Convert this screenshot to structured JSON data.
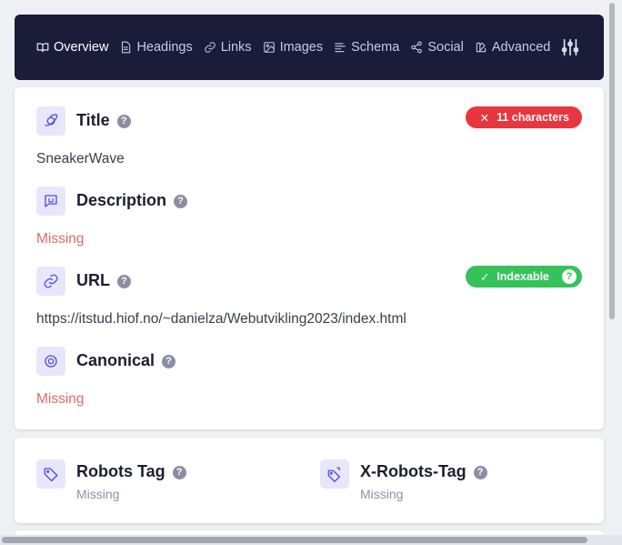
{
  "nav": {
    "items": [
      {
        "label": "Overview",
        "icon": "book-open-icon",
        "active": true
      },
      {
        "label": "Headings",
        "icon": "document-icon",
        "active": false
      },
      {
        "label": "Links",
        "icon": "link-icon",
        "active": false
      },
      {
        "label": "Images",
        "icon": "image-icon",
        "active": false
      },
      {
        "label": "Schema",
        "icon": "align-left-icon",
        "active": false
      },
      {
        "label": "Social",
        "icon": "share-icon",
        "active": false
      },
      {
        "label": "Advanced",
        "icon": "paint-icon",
        "active": false
      }
    ],
    "settings_icon": "sliders-icon"
  },
  "overview": {
    "title": {
      "label": "Title",
      "value": "SneakerWave",
      "badge": "11 characters",
      "badge_symbol": "✕",
      "badge_color": "#e8363f"
    },
    "description": {
      "label": "Description",
      "value": "Missing"
    },
    "url": {
      "label": "URL",
      "value": "https://itstud.hiof.no/~danielza/Webutvikling2023/index.html",
      "badge": "Indexable",
      "badge_symbol": "✓",
      "badge_color": "#35c25a"
    },
    "canonical": {
      "label": "Canonical",
      "value": "Missing"
    },
    "help_symbol": "?"
  },
  "robots": {
    "robots_tag": {
      "label": "Robots Tag",
      "value": "Missing"
    },
    "x_robots_tag": {
      "label": "X-Robots-Tag",
      "value": "Missing"
    }
  },
  "colors": {
    "nav_bg": "#1b1b3a",
    "accent": "#5b4be0",
    "missing": "#e8686a"
  }
}
